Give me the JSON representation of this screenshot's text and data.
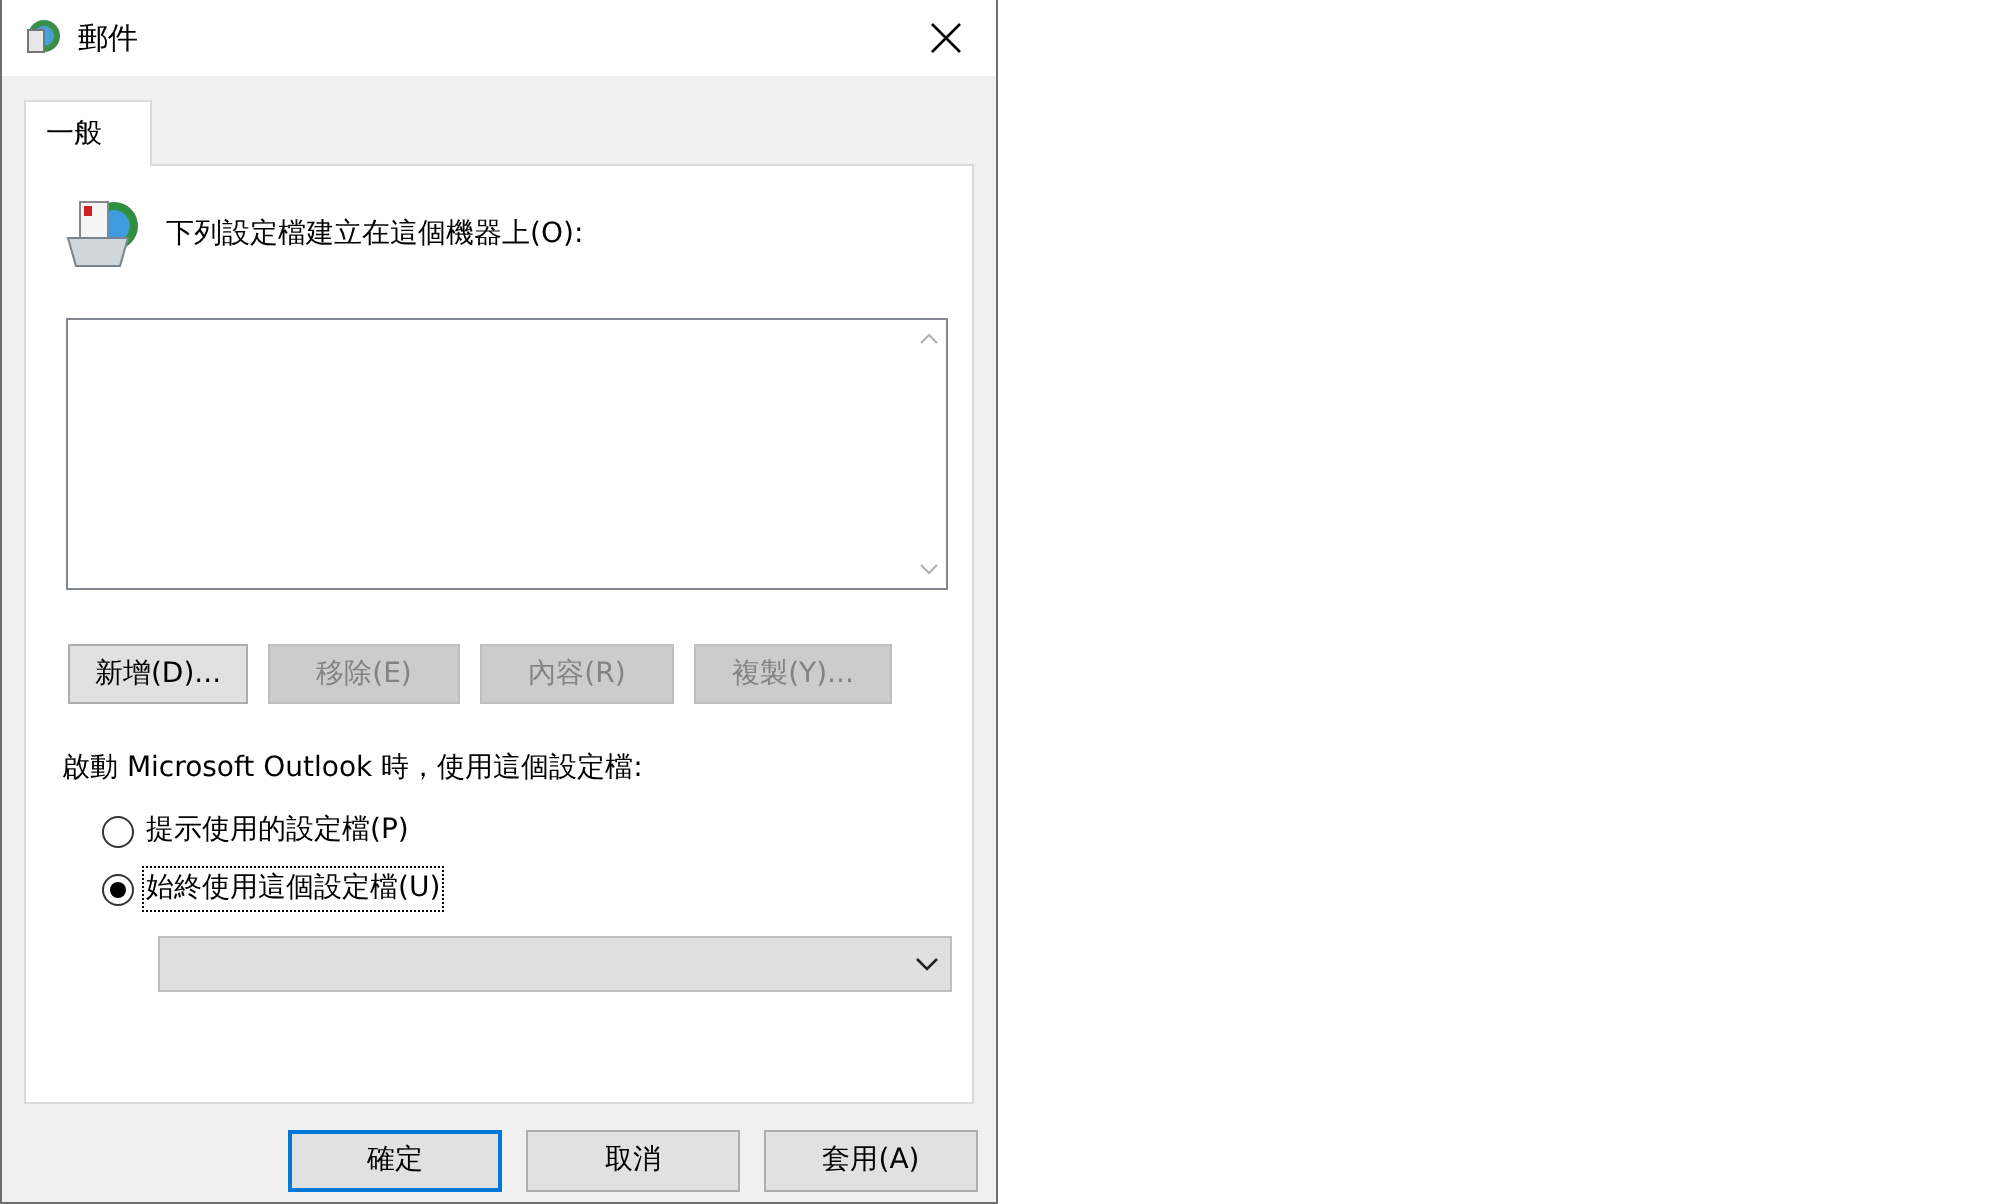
{
  "window": {
    "title": "郵件"
  },
  "tabs": [
    {
      "label": "一般",
      "selected": true
    }
  ],
  "profiles_label": "下列設定檔建立在這個機器上(O):",
  "profile_buttons": [
    {
      "label": "新增(D)...",
      "disabled": false
    },
    {
      "label": "移除(E)",
      "disabled": true
    },
    {
      "label": "內容(R)",
      "disabled": true
    },
    {
      "label": "複製(Y)...",
      "disabled": true
    }
  ],
  "startup_label": "啟動 Microsoft Outlook 時，使用這個設定檔:",
  "startup_options": [
    {
      "label": "提示使用的設定檔(P)",
      "selected": false
    },
    {
      "label": "始終使用這個設定檔(U)",
      "selected": true
    }
  ],
  "profile_dropdown": {
    "disabled": true
  },
  "dialog_buttons": [
    {
      "label": "確定",
      "default": true
    },
    {
      "label": "取消",
      "default": false
    },
    {
      "label": "套用(A)",
      "default": false
    }
  ]
}
